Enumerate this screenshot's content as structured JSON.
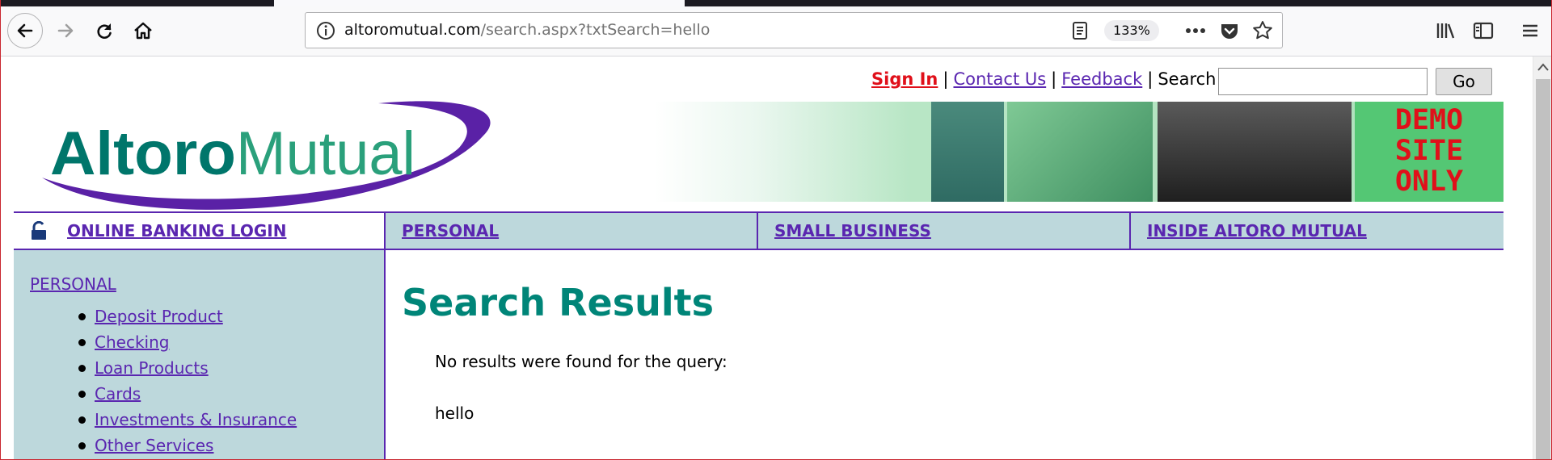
{
  "browser": {
    "url_domain": "altoromutual.com",
    "url_path": "/search.aspx?txtSearch=hello",
    "zoom": "133%"
  },
  "site": {
    "logo_text": "AltoroMutual",
    "banner_demo_lines": [
      "DEMO",
      "SITE",
      "ONLY"
    ],
    "top_links": {
      "sign_in": "Sign In",
      "contact_us": "Contact Us",
      "feedback": "Feedback",
      "separator": "|",
      "search_label": "Search",
      "search_value": "",
      "go_button": "Go"
    },
    "nav": {
      "login": "ONLINE BANKING LOGIN",
      "personal": "PERSONAL",
      "small_business": "SMALL BUSINESS",
      "inside": "INSIDE ALTORO MUTUAL"
    },
    "sidebar": {
      "heading": "PERSONAL",
      "items": [
        {
          "label": "Deposit Product"
        },
        {
          "label": "Checking"
        },
        {
          "label": "Loan Products"
        },
        {
          "label": "Cards"
        },
        {
          "label": "Investments & Insurance"
        },
        {
          "label": "Other Services"
        }
      ]
    },
    "content": {
      "title": "Search Results",
      "no_results": "No results were found for the query:",
      "query": "hello"
    }
  }
}
